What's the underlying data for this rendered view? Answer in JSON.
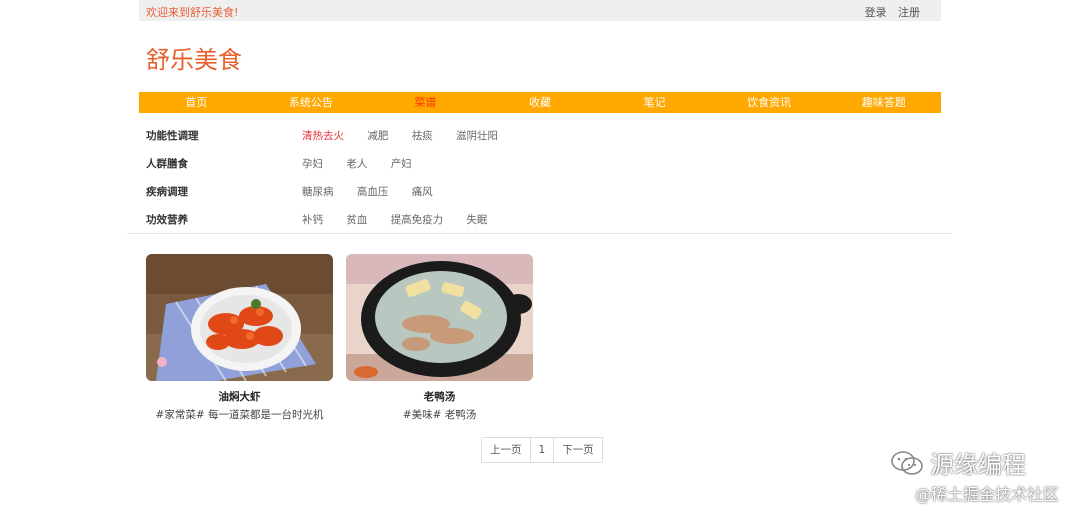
{
  "topbar": {
    "welcome": "欢迎来到舒乐美食!",
    "login": "登录",
    "register": "注册"
  },
  "logo": "舒乐美食",
  "nav": [
    "首页",
    "系统公告",
    "菜谱",
    "收藏",
    "笔记",
    "饮食资讯",
    "趣味答题"
  ],
  "nav_active": 2,
  "filters": [
    {
      "category": "功能性调理",
      "options": [
        "清热去火",
        "减肥",
        "祛痰",
        "滋阴壮阳"
      ]
    },
    {
      "category": "人群膳食",
      "options": [
        "孕妇",
        "老人",
        "产妇"
      ]
    },
    {
      "category": "疾病调理",
      "options": [
        "糖尿病",
        "高血压",
        "痛风"
      ]
    },
    {
      "category": "功效营养",
      "options": [
        "补钙",
        "贫血",
        "提高免疫力",
        "失眠"
      ]
    }
  ],
  "recipes": [
    {
      "title": "油焖大虾",
      "tags": "#家常菜# 每一道菜都是一台时光机",
      "image_icon": "shrimp-dish"
    },
    {
      "title": "老鸭汤",
      "tags": "#美味# 老鸭汤",
      "image_icon": "duck-soup-dish"
    }
  ],
  "pagination": {
    "prev": "上一页",
    "current": "1",
    "next": "下一页"
  },
  "watermark": {
    "brand": "源缘编程",
    "site": "@稀土掘金技术社区"
  },
  "colors": {
    "accent": "#ffa800",
    "logo": "#e8602c",
    "active_filter": "#e8303c"
  }
}
